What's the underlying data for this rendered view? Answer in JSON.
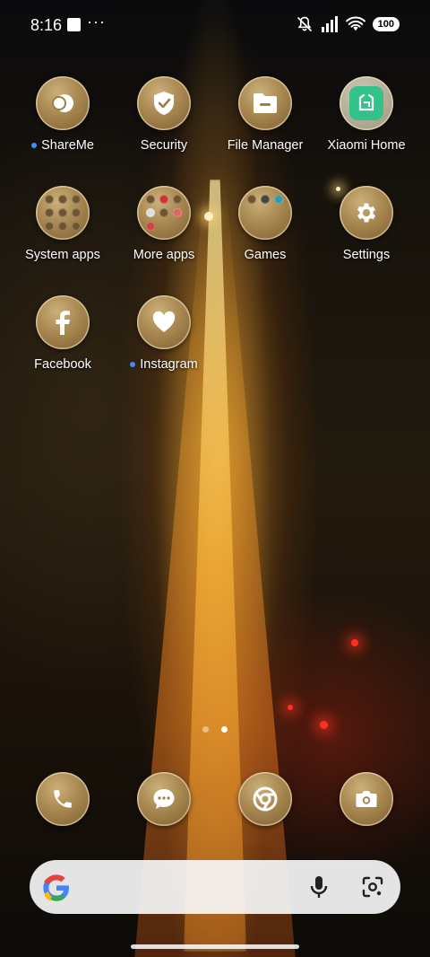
{
  "status_bar": {
    "time": "8:16",
    "more_glyph": "···",
    "battery": "100",
    "icons": [
      "image-icon",
      "mute-icon",
      "signal-icon",
      "wifi-icon",
      "battery-icon"
    ]
  },
  "apps": [
    {
      "label": "ShareMe",
      "icon": "shareme-icon",
      "new_dot": true
    },
    {
      "label": "Security",
      "icon": "shield-check-icon",
      "new_dot": false
    },
    {
      "label": "File Manager",
      "icon": "folder-icon",
      "new_dot": false
    },
    {
      "label": "Xiaomi Home",
      "icon": "xiaomi-home-icon",
      "new_dot": false
    },
    {
      "label": "System apps",
      "icon": "folder-icon",
      "new_dot": false
    },
    {
      "label": "More apps",
      "icon": "folder-icon",
      "new_dot": false
    },
    {
      "label": "Games",
      "icon": "folder-icon",
      "new_dot": false
    },
    {
      "label": "Settings",
      "icon": "gear-icon",
      "new_dot": false
    },
    {
      "label": "Facebook",
      "icon": "facebook-icon",
      "new_dot": false
    },
    {
      "label": "Instagram",
      "icon": "heart-icon",
      "new_dot": true
    }
  ],
  "page_indicator": {
    "pages": 2,
    "current": 2
  },
  "dock": [
    {
      "name": "phone",
      "icon": "phone-icon"
    },
    {
      "name": "messages",
      "icon": "message-icon"
    },
    {
      "name": "chrome",
      "icon": "chrome-icon"
    },
    {
      "name": "camera",
      "icon": "camera-icon"
    }
  ],
  "search_bar": {
    "logo": "G",
    "icons": [
      "microphone-icon",
      "lens-icon"
    ]
  },
  "colors": {
    "accent_gold": "#a88750",
    "google_blue": "#4285f4",
    "google_red": "#ea4335",
    "google_yellow": "#fbbc05",
    "google_green": "#34a853",
    "notify_dot": "#3e8cff"
  }
}
